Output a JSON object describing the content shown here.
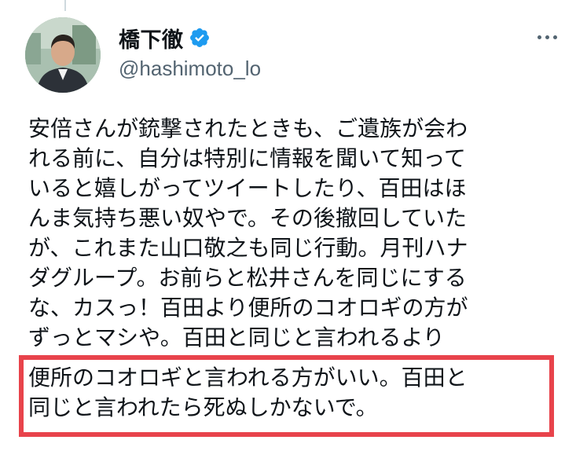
{
  "tweet": {
    "author": {
      "display_name": "橋下徹",
      "handle": "@hashimoto_lo",
      "verified": true,
      "verified_icon": "verified-badge-icon",
      "verified_color": "#1d9bf0"
    },
    "more_icon": "more-horizontal-icon",
    "body_lines": [
      "安倍さんが銃撃されたときも、ご遺族が会わ",
      "れる前に、自分は特別に情報を聞いて知って",
      "いると嬉しがってツイートしたり、百田はほ",
      "んま気持ち悪い奴やで。その後撤回していた",
      "が、これまた山口敬之も同じ行動。月刊ハナ",
      "ダグループ。お前らと松井さんを同じにする",
      "な、カスっ！百田より便所のコオロギの方が",
      "ずっとマシや。百田と同じと言われるより"
    ],
    "highlighted_lines": [
      "便所のコオロギと言われる方がいい。百田と",
      "同じと言われたら死ぬしかないで。"
    ],
    "highlight_color": "#e8434b"
  }
}
